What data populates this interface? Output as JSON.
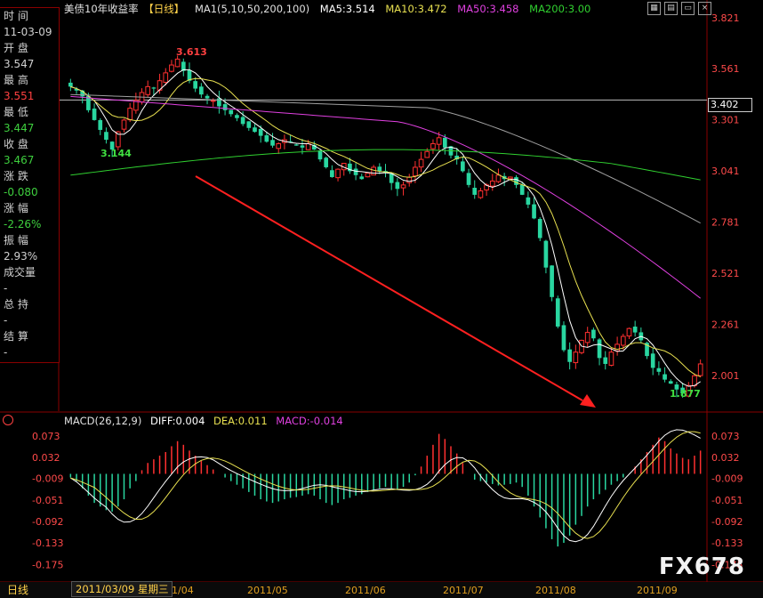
{
  "header": {
    "title": "美债10年收益率",
    "period": "【日线】",
    "ma_label": "MA1(5,10,50,200,100)",
    "ma5": "MA5:3.514",
    "ma10": "MA10:3.472",
    "ma50": "MA50:3.458",
    "ma200": "MA200:3.00"
  },
  "info_panel": {
    "time_label": "时 间",
    "time_value": "11-03-09",
    "open_label": "开 盘",
    "open_value": "3.547",
    "high_label": "最 高",
    "high_value": "3.551",
    "low_label": "最 低",
    "low_value": "3.447",
    "close_label": "收 盘",
    "close_value": "3.467",
    "change_label": "涨 跌",
    "change_value": "-0.080",
    "pct_label": "涨 幅",
    "pct_value": "-2.26%",
    "amp_label": "振 幅",
    "amp_value": "2.93%",
    "volume_label": "成交量",
    "volume_value": "-",
    "hold_label": "总 持",
    "hold_value": "-",
    "settle_label": "结 算",
    "settle_value": "-"
  },
  "current_price": "3.402",
  "annotations": {
    "high": "3.613",
    "low1": "3.144",
    "low2": "1.877"
  },
  "macd_header": {
    "label": "MACD(26,12,9)",
    "diff": "DIFF:0.004",
    "dea": "DEA:0.011",
    "macd": "MACD:-0.014"
  },
  "bottom": {
    "period_tab": "日线",
    "date": "2011/03/09 星期三",
    "x_labels": [
      "1/04",
      "2011/05",
      "2011/06",
      "2011/07",
      "2011/08",
      "2011/09"
    ],
    "watermark": "FX678"
  },
  "colors": {
    "up": "#ff3030",
    "down": "#29d6a0",
    "ma5": "#ffffff",
    "ma10": "#e8e050",
    "ma50": "#e040e0",
    "ma200": "#30d030",
    "ma100": "#a0a0a0",
    "trend_arrow": "#ff2020"
  },
  "chart_data": {
    "type": "candlestick",
    "y_ticks": [
      "3.821",
      "3.561",
      "3.301",
      "3.041",
      "2.781",
      "2.521",
      "2.261",
      "2.001"
    ],
    "ylim": [
      1.82,
      3.82
    ],
    "macd_y_ticks": [
      "0.073",
      "0.032",
      "-0.009",
      "-0.051",
      "-0.092",
      "-0.133",
      "-0.175"
    ],
    "macd_ylim": [
      -0.205,
      0.09
    ],
    "closes": [
      3.47,
      3.45,
      3.42,
      3.35,
      3.3,
      3.25,
      3.2,
      3.15,
      3.24,
      3.3,
      3.36,
      3.4,
      3.44,
      3.47,
      3.46,
      3.5,
      3.54,
      3.58,
      3.61,
      3.55,
      3.5,
      3.46,
      3.43,
      3.41,
      3.4,
      3.37,
      3.35,
      3.33,
      3.31,
      3.28,
      3.26,
      3.24,
      3.22,
      3.19,
      3.17,
      3.18,
      3.2,
      3.19,
      3.17,
      3.16,
      3.18,
      3.15,
      3.1,
      3.06,
      3.01,
      3.05,
      3.08,
      3.04,
      3.02,
      3.0,
      3.03,
      3.06,
      3.04,
      3.03,
      2.98,
      2.95,
      2.97,
      3.01,
      3.06,
      3.1,
      3.14,
      3.18,
      3.21,
      3.16,
      3.12,
      3.1,
      3.04,
      2.97,
      2.92,
      2.94,
      2.97,
      2.99,
      3.02,
      3.0,
      3.01,
      2.97,
      2.92,
      2.87,
      2.8,
      2.7,
      2.55,
      2.4,
      2.25,
      2.13,
      2.07,
      2.12,
      2.18,
      2.22,
      2.19,
      2.09,
      2.06,
      2.12,
      2.16,
      2.2,
      2.24,
      2.22,
      2.18,
      2.1,
      2.04,
      2.02,
      1.98,
      1.96,
      1.93,
      1.91,
      1.95,
      2.0,
      2.06
    ],
    "macd": [
      -0.005,
      -0.01,
      -0.02,
      -0.03,
      -0.04,
      -0.045,
      -0.05,
      -0.052,
      -0.045,
      -0.035,
      -0.02,
      -0.01,
      0.005,
      0.015,
      0.02,
      0.025,
      0.03,
      0.038,
      0.045,
      0.04,
      0.032,
      0.025,
      0.018,
      0.012,
      0.006,
      0.0,
      -0.005,
      -0.01,
      -0.015,
      -0.02,
      -0.025,
      -0.03,
      -0.035,
      -0.038,
      -0.04,
      -0.038,
      -0.035,
      -0.033,
      -0.032,
      -0.03,
      -0.028,
      -0.03,
      -0.035,
      -0.04,
      -0.043,
      -0.04,
      -0.035,
      -0.033,
      -0.03,
      -0.028,
      -0.025,
      -0.022,
      -0.02,
      -0.018,
      -0.02,
      -0.022,
      -0.018,
      -0.012,
      -0.002,
      0.01,
      0.025,
      0.04,
      0.055,
      0.048,
      0.038,
      0.028,
      0.015,
      0.0,
      -0.008,
      -0.01,
      -0.012,
      -0.014,
      -0.016,
      -0.015,
      -0.014,
      -0.012,
      -0.018,
      -0.03,
      -0.045,
      -0.06,
      -0.075,
      -0.09,
      -0.1,
      -0.095,
      -0.085,
      -0.07,
      -0.058,
      -0.045,
      -0.035,
      -0.028,
      -0.022,
      -0.015,
      -0.01,
      -0.005,
      0.0,
      0.01,
      0.02,
      0.03,
      0.04,
      0.05,
      0.045,
      0.035,
      0.028,
      0.022,
      0.02,
      0.025,
      0.032
    ]
  }
}
